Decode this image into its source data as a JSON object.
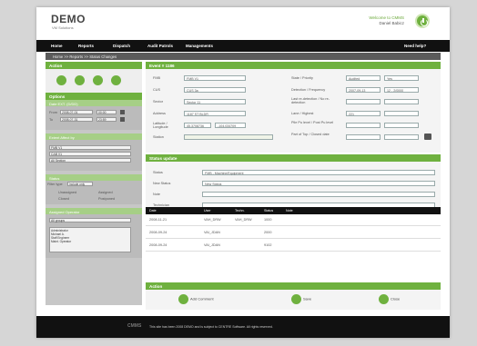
{
  "header": {
    "logo": "DEMO",
    "logo_sub": "VM Solutions",
    "welcome": "Welcome to CMMS",
    "username": "Daniel Babicz"
  },
  "nav": {
    "home": "Home",
    "reports": "Reports",
    "dispatch": "Dispatch",
    "audit_patrols": "Audit Patrols",
    "managements": "Managements",
    "help": "Need help?"
  },
  "breadcrumb": "Home >> Reports >> Status Changes",
  "left": {
    "action_title": "Action",
    "options_title": "Options",
    "date_range_title": "Date EXT. (D/DD)",
    "from_label": "From",
    "from_value": "2008-07-01",
    "to_label": "To",
    "to_value": "2008-07-31",
    "from_time": "00:00",
    "to_time": "23:59",
    "filter_title": "Extent Affect by",
    "sel1": "FMB V1",
    "sel2": "CAB V1",
    "sel3": "All Section",
    "status_title": "Status",
    "filter_type_label": "Filter type",
    "filter_type_value": "Include only",
    "chk_unassigned": "Unassigned",
    "chk_assigned": "Assigned",
    "chk_closed": "Closed",
    "chk_postponed": "Postponed",
    "assigned_title": "Assigned Operator",
    "assign_select": "All groups",
    "list_items": [
      "Administrator",
      "Michael A.",
      "Staff Engineer",
      "Maint. Operator"
    ]
  },
  "event": {
    "title": "Event # 1186",
    "fields_left": [
      {
        "label": "FMB",
        "value": "FMB V1"
      },
      {
        "label": "CUS",
        "value": "CUS 3a"
      },
      {
        "label": "Sector",
        "value": "Sector 11"
      },
      {
        "label": "Address",
        "value": "1187 ST BLDR"
      },
      {
        "label": "Latitude / Longitude",
        "value": "45.3708736"
      },
      {
        "label": "Station",
        "value": ""
      }
    ],
    "longitude_value": "-104.034709",
    "fields_right": [
      {
        "label": "State / Priority",
        "value": "Audited",
        "value2": "Yes"
      },
      {
        "label": "Detection / Frequency",
        "value": "2007-09-13",
        "value2": "12 - 2/0000"
      },
      {
        "label": "Last re-detection / No re-detection",
        "value": "",
        "value2": ""
      },
      {
        "label": "Lane / Highest",
        "value": "221",
        "value2": ""
      },
      {
        "label": "Pile Pu level / Post Pu level",
        "value": "",
        "value2": ""
      },
      {
        "label": "Part of Top / Closed date",
        "value": "",
        "value2": ""
      }
    ]
  },
  "status_update": {
    "title": "Status update",
    "status_label": "Status",
    "status_value": "FMB - Machine/Equipment",
    "new_status_label": "New Status",
    "new_status_value": "New Status",
    "note_label": "Note",
    "technician_label": "Technician"
  },
  "table": {
    "headers": [
      "Date",
      "User",
      "Techn.",
      "Status",
      "Note"
    ],
    "rows": [
      [
        "2008-11-21",
        "VAH_DRW",
        "VAH_DRW",
        "1000",
        ""
      ],
      [
        "2008-09-24",
        "VAI_JDAN",
        "",
        "2000",
        ""
      ],
      [
        "2008-09-24",
        "VAI_JDAN",
        "",
        "9102",
        ""
      ]
    ]
  },
  "action": {
    "title": "Action",
    "add_comment": "Add Comment",
    "save": "Save",
    "close": "Close"
  },
  "footer": {
    "brand": "CMMS",
    "text": "This site has been 2008 DEMO and is subject to CENTRE Software. All rights reserved."
  }
}
